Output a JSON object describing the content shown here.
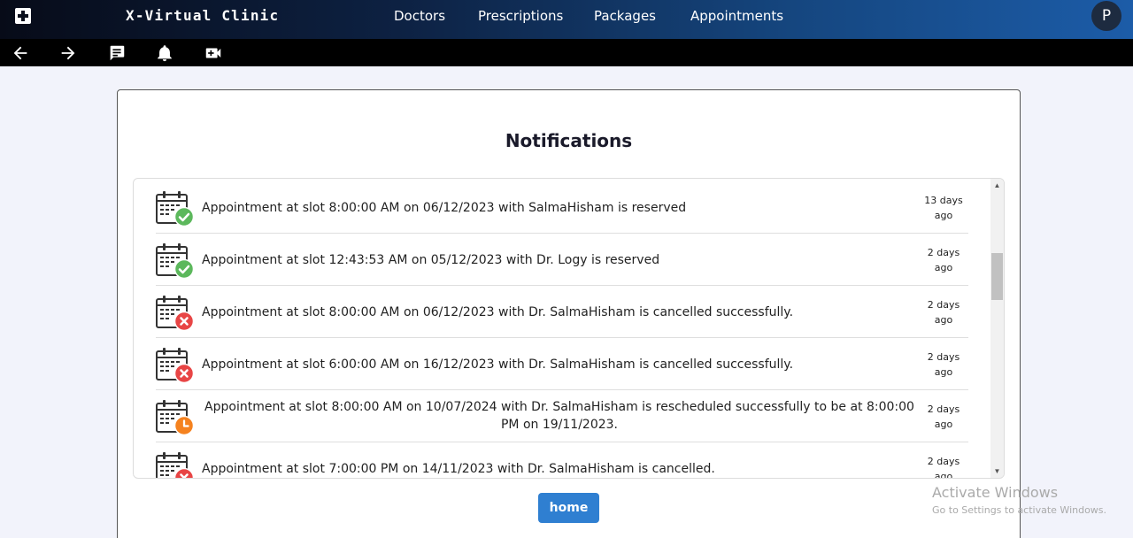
{
  "app": {
    "brand": "X-Virtual Clinic",
    "nav": [
      "Doctors",
      "Prescriptions",
      "Packages",
      "Appointments"
    ],
    "avatar_letter": "P"
  },
  "toolbar": {
    "icons": [
      "back-arrow-icon",
      "forward-arrow-icon",
      "chat-icon",
      "bell-icon",
      "video-call-icon"
    ]
  },
  "page": {
    "title": "Notifications",
    "home_label": "home"
  },
  "notifications": [
    {
      "status": "reserved",
      "text": "Appointment at slot 8:00:00 AM on 06/12/2023 with SalmaHisham is reserved",
      "time_line1": "13 days",
      "time_line2": "ago"
    },
    {
      "status": "reserved",
      "text": "Appointment at slot 12:43:53 AM on 05/12/2023 with Dr. Logy is reserved",
      "time_line1": "2 days",
      "time_line2": "ago"
    },
    {
      "status": "cancelled",
      "text": "Appointment at slot 8:00:00 AM on 06/12/2023 with Dr. SalmaHisham is cancelled successfully.",
      "time_line1": "2 days",
      "time_line2": "ago"
    },
    {
      "status": "cancelled",
      "text": "Appointment at slot 6:00:00 AM on 16/12/2023 with Dr. SalmaHisham is cancelled successfully.",
      "time_line1": "2 days",
      "time_line2": "ago"
    },
    {
      "status": "rescheduled",
      "text": "Appointment at slot 8:00:00 AM on 10/07/2024 with Dr. SalmaHisham is rescheduled successfully to be at 8:00:00 PM on 19/11/2023.",
      "time_line1": "2 days",
      "time_line2": "ago"
    },
    {
      "status": "cancelled",
      "text": "Appointment at slot 7:00:00 PM on 14/11/2023 with Dr. SalmaHisham is cancelled.",
      "time_line1": "2 days",
      "time_line2": "ago"
    }
  ],
  "status_colors": {
    "reserved": "#5cb85c",
    "cancelled": "#e84545",
    "rescheduled": "#f5821f"
  },
  "watermark": {
    "title": "Activate Windows",
    "subtitle": "Go to Settings to activate Windows."
  }
}
